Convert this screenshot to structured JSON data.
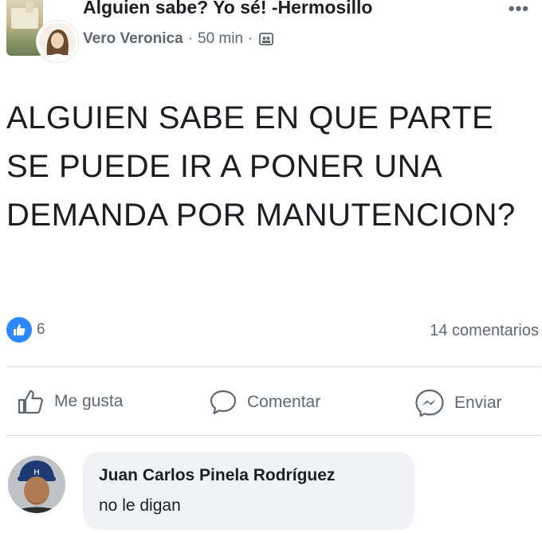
{
  "post": {
    "group_title": "Alguien sabe? Yo sé! -Hermosillo",
    "author": "Vero Veronica",
    "separator": "·",
    "time": "50 min",
    "audience_icon": "group-icon",
    "more_icon": "more-dots-icon",
    "more_label": "•••",
    "text": "ALGUIEN SABE EN QUE PARTE SE PUEDE IR A PONER UNA DEMANDA POR MANUTENCION?"
  },
  "stats": {
    "reaction_icon": "like-badge-icon",
    "reaction_count": "6",
    "comment_count": "14 comentarios"
  },
  "actions": {
    "like_label": "Me gusta",
    "comment_label": "Comentar",
    "send_label": "Enviar"
  },
  "comment": {
    "author": "Juan Carlos Pinela Rodríguez",
    "text": "no le digan"
  },
  "colors": {
    "accent": "#2d88ff",
    "secondary_text": "#606770",
    "bubble": "#f0f2f5",
    "divider": "#dadde1"
  }
}
